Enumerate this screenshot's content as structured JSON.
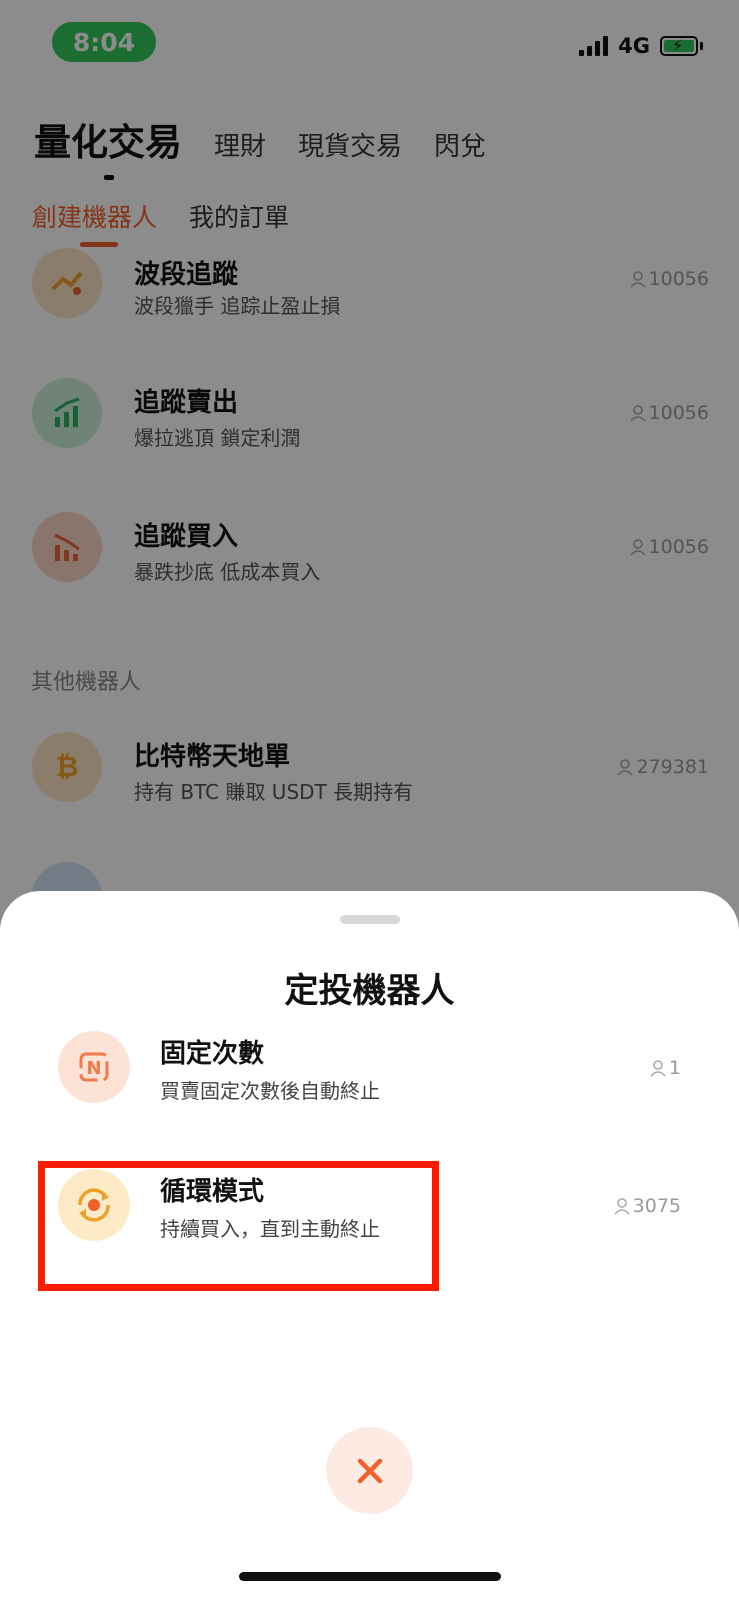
{
  "status_bar": {
    "time": "8:04",
    "network": "4G"
  },
  "header": {
    "tabs": [
      {
        "label": "量化交易",
        "active": true
      },
      {
        "label": "理財"
      },
      {
        "label": "現貨交易"
      },
      {
        "label": "閃兌"
      }
    ],
    "sub_tabs": [
      {
        "label": "創建機器人",
        "active": true
      },
      {
        "label": "我的訂單"
      }
    ]
  },
  "robots": [
    {
      "title": "波段追蹤",
      "desc": "波段獵手 追踪止盈止損",
      "count": "10056",
      "icon": "swing-icon",
      "icon_bg": "#fbe4c4"
    },
    {
      "title": "追蹤賣出",
      "desc": "爆拉逃頂 鎖定利潤",
      "count": "10056",
      "icon": "trend-up-icon",
      "icon_bg": "#cdeed9"
    },
    {
      "title": "追蹤買入",
      "desc": "暴跌抄底 低成本買入",
      "count": "10056",
      "icon": "trend-down-icon",
      "icon_bg": "#fbd5c6"
    }
  ],
  "other_section": {
    "label": "其他機器人",
    "items": [
      {
        "title": "比特幣天地單",
        "desc": "持有 BTC 賺取 USDT 長期持有",
        "count": "279381",
        "icon": "bitcoin-icon"
      }
    ]
  },
  "sheet": {
    "title": "定投機器人",
    "options": [
      {
        "title": "固定次數",
        "desc": "買賣固定次數後自動終止",
        "count": "1",
        "icon": "fixed-count-icon"
      },
      {
        "title": "循環模式",
        "desc": "持續買入，直到主動終止",
        "count": "3075",
        "icon": "cycle-icon",
        "highlighted": true
      }
    ]
  },
  "colors": {
    "accent": "#f0602a",
    "highlight": "#ff1a00",
    "success": "#33c759"
  }
}
